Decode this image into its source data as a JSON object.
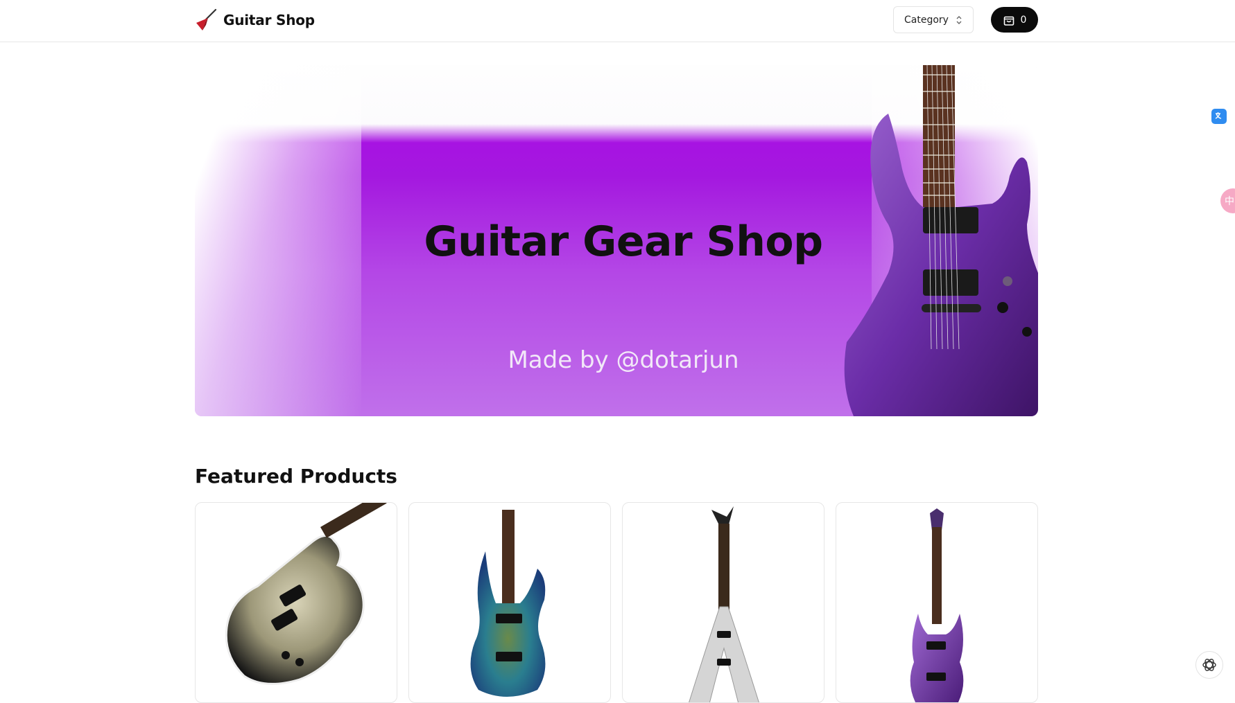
{
  "header": {
    "brand_title": "Guitar Shop",
    "logo_icon": "guitar-logo-icon",
    "category_label": "Category",
    "category_icon": "chevron-up-down-icon",
    "cart_icon": "shopping-bag-icon",
    "cart_count": "0"
  },
  "hero": {
    "title": "Guitar Gear Shop",
    "subtitle": "Made by @dotarjun",
    "image": "purple-electric-guitar"
  },
  "featured": {
    "title": "Featured Products",
    "products": [
      {
        "image": "silverburst-single-cut-guitar"
      },
      {
        "image": "blue-burl-superstrat-guitar"
      },
      {
        "image": "silver-flying-v-guitar"
      },
      {
        "image": "purple-superstrat-guitar"
      }
    ]
  },
  "floating": {
    "translate_icon": "translate-icon",
    "pink_badge_text": "中",
    "ai_icon": "openai-icon"
  },
  "colors": {
    "accent": "#a713e2",
    "hero_bottom": "#c070ea",
    "cart_button": "#0b0b0b"
  }
}
